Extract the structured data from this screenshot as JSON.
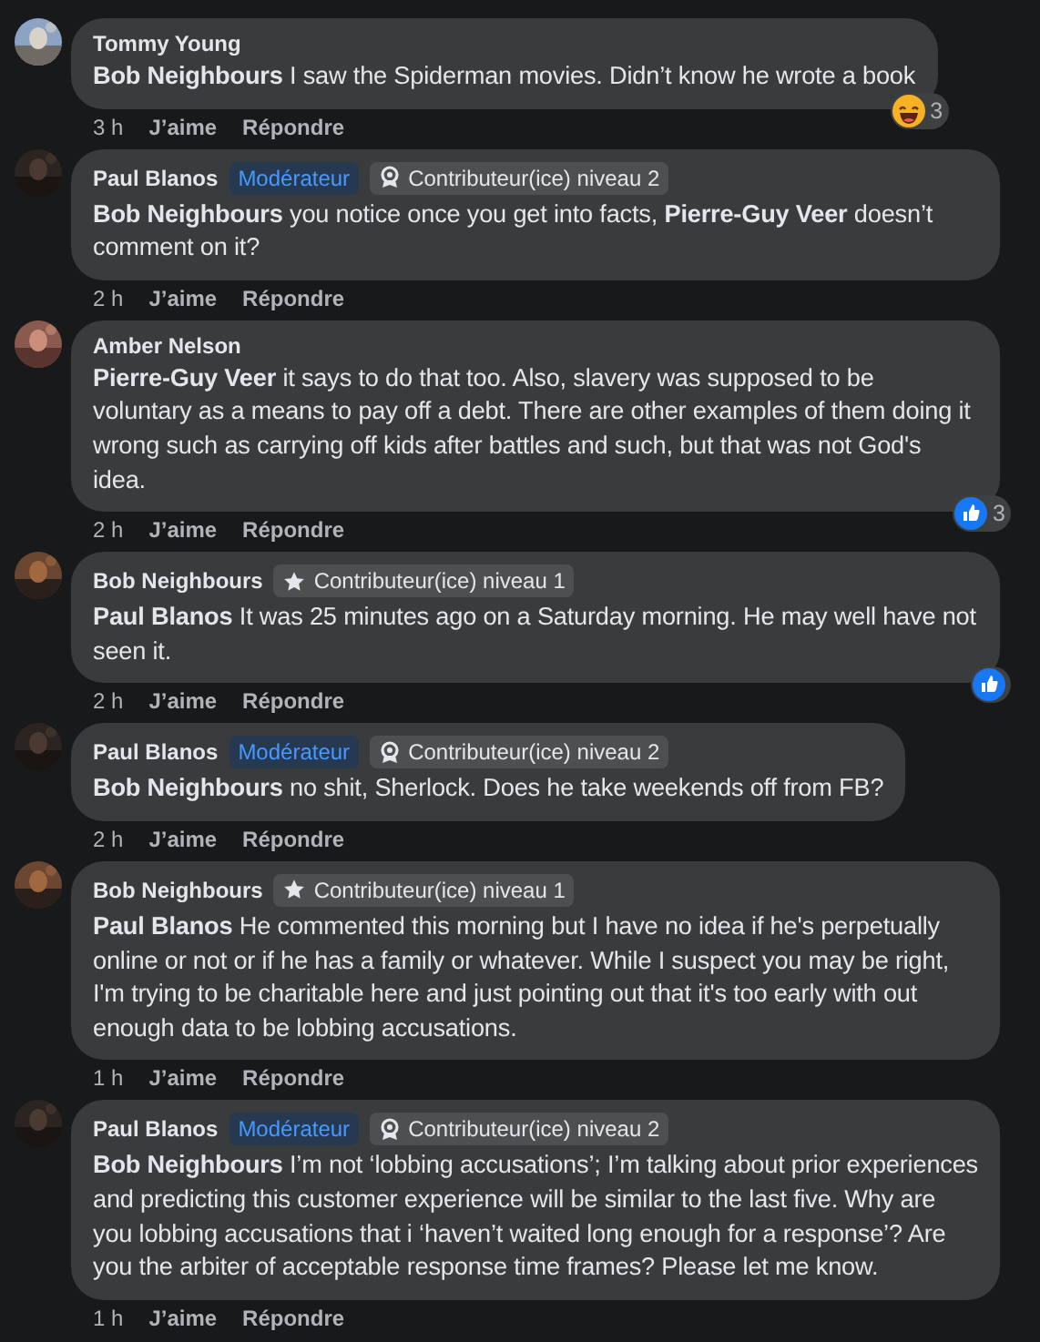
{
  "comments": [
    {
      "author": "Tommy Young",
      "avatar": {
        "kind": "picture"
      },
      "text": "**Bob Neighbours** I saw the Spiderman movies. Didn’t know he wrote a book",
      "time": "3 h",
      "like": "J’aime",
      "reply": "Répondre",
      "reaction": {
        "kind": "haha",
        "count": "3"
      }
    },
    {
      "author": "Paul Blanos",
      "avatar": {
        "kind": "picture"
      },
      "badges": [
        {
          "kind": "moderator",
          "label": "Modérateur"
        },
        {
          "kind": "medal",
          "label": "Contributeur(ice) niveau 2"
        }
      ],
      "text": "**Bob Neighbours** you notice once you get into facts, **Pierre-Guy Veer** doesn’t comment on it?",
      "time": "2 h",
      "like": "J’aime",
      "reply": "Répondre"
    },
    {
      "author": "Amber Nelson",
      "avatar": {
        "kind": "picture"
      },
      "text": "**Pierre-Guy Veer** it says to do that too. Also, slavery was supposed to be voluntary as a means to pay off a debt. There are other examples of them doing it wrong such as carrying off kids after battles and such, but that was not God's idea.",
      "time": "2 h",
      "like": "J’aime",
      "reply": "Répondre",
      "reaction": {
        "kind": "like",
        "count": "3"
      }
    },
    {
      "author": "Bob Neighbours",
      "avatar": {
        "kind": "picture"
      },
      "badges": [
        {
          "kind": "star",
          "label": "Contributeur(ice) niveau 1"
        }
      ],
      "text": "**Paul Blanos** It was 25 minutes ago on a Saturday morning. He may well have not seen it.",
      "time": "2 h",
      "like": "J’aime",
      "reply": "Répondre",
      "reaction": {
        "kind": "like"
      }
    },
    {
      "author": "Paul Blanos",
      "avatar": {
        "kind": "picture"
      },
      "badges": [
        {
          "kind": "moderator",
          "label": "Modérateur"
        },
        {
          "kind": "medal",
          "label": "Contributeur(ice) niveau 2"
        }
      ],
      "text": "**Bob Neighbours** no shit, Sherlock. Does he take weekends off from FB?",
      "time": "2 h",
      "like": "J’aime",
      "reply": "Répondre"
    },
    {
      "author": "Bob Neighbours",
      "avatar": {
        "kind": "picture"
      },
      "badges": [
        {
          "kind": "star",
          "label": "Contributeur(ice) niveau 1"
        }
      ],
      "text": "**Paul Blanos** He commented this morning but I have no idea if he's perpetually online or not or if he has a family or whatever. While I suspect you may be right, I'm trying to be charitable here and just pointing out that it's too early with out enough data to be lobbing accusations.",
      "time": "1 h",
      "like": "J’aime",
      "reply": "Répondre"
    },
    {
      "author": "Paul Blanos",
      "avatar": {
        "kind": "picture"
      },
      "badges": [
        {
          "kind": "moderator",
          "label": "Modérateur"
        },
        {
          "kind": "medal",
          "label": "Contributeur(ice) niveau 2"
        }
      ],
      "text": "**Bob Neighbours** I’m not ‘lobbing accusations’; I’m talking about prior experiences and predicting this customer experience will be similar to the last five. Why are you lobbing accusations that i ‘haven’t waited long enough for a response’? Are you the arbiter of acceptable response time frames? Please let me know.",
      "time": "1 h",
      "like": "J’aime",
      "reply": "Répondre"
    }
  ]
}
